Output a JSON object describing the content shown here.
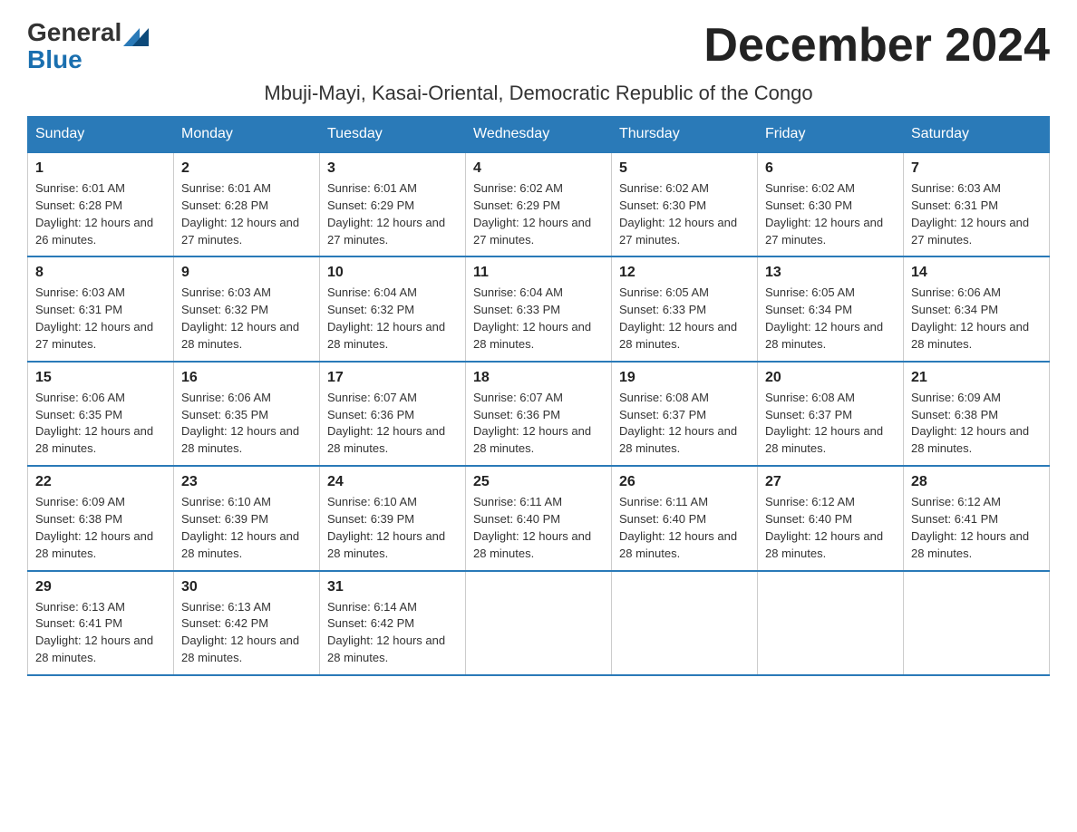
{
  "header": {
    "logo_general": "General",
    "logo_blue": "Blue",
    "page_title": "December 2024",
    "subtitle": "Mbuji-Mayi, Kasai-Oriental, Democratic Republic of the Congo"
  },
  "days_of_week": [
    "Sunday",
    "Monday",
    "Tuesday",
    "Wednesday",
    "Thursday",
    "Friday",
    "Saturday"
  ],
  "weeks": [
    [
      {
        "day": "1",
        "sunrise": "6:01 AM",
        "sunset": "6:28 PM",
        "daylight": "12 hours and 26 minutes."
      },
      {
        "day": "2",
        "sunrise": "6:01 AM",
        "sunset": "6:28 PM",
        "daylight": "12 hours and 27 minutes."
      },
      {
        "day": "3",
        "sunrise": "6:01 AM",
        "sunset": "6:29 PM",
        "daylight": "12 hours and 27 minutes."
      },
      {
        "day": "4",
        "sunrise": "6:02 AM",
        "sunset": "6:29 PM",
        "daylight": "12 hours and 27 minutes."
      },
      {
        "day": "5",
        "sunrise": "6:02 AM",
        "sunset": "6:30 PM",
        "daylight": "12 hours and 27 minutes."
      },
      {
        "day": "6",
        "sunrise": "6:02 AM",
        "sunset": "6:30 PM",
        "daylight": "12 hours and 27 minutes."
      },
      {
        "day": "7",
        "sunrise": "6:03 AM",
        "sunset": "6:31 PM",
        "daylight": "12 hours and 27 minutes."
      }
    ],
    [
      {
        "day": "8",
        "sunrise": "6:03 AM",
        "sunset": "6:31 PM",
        "daylight": "12 hours and 27 minutes."
      },
      {
        "day": "9",
        "sunrise": "6:03 AM",
        "sunset": "6:32 PM",
        "daylight": "12 hours and 28 minutes."
      },
      {
        "day": "10",
        "sunrise": "6:04 AM",
        "sunset": "6:32 PM",
        "daylight": "12 hours and 28 minutes."
      },
      {
        "day": "11",
        "sunrise": "6:04 AM",
        "sunset": "6:33 PM",
        "daylight": "12 hours and 28 minutes."
      },
      {
        "day": "12",
        "sunrise": "6:05 AM",
        "sunset": "6:33 PM",
        "daylight": "12 hours and 28 minutes."
      },
      {
        "day": "13",
        "sunrise": "6:05 AM",
        "sunset": "6:34 PM",
        "daylight": "12 hours and 28 minutes."
      },
      {
        "day": "14",
        "sunrise": "6:06 AM",
        "sunset": "6:34 PM",
        "daylight": "12 hours and 28 minutes."
      }
    ],
    [
      {
        "day": "15",
        "sunrise": "6:06 AM",
        "sunset": "6:35 PM",
        "daylight": "12 hours and 28 minutes."
      },
      {
        "day": "16",
        "sunrise": "6:06 AM",
        "sunset": "6:35 PM",
        "daylight": "12 hours and 28 minutes."
      },
      {
        "day": "17",
        "sunrise": "6:07 AM",
        "sunset": "6:36 PM",
        "daylight": "12 hours and 28 minutes."
      },
      {
        "day": "18",
        "sunrise": "6:07 AM",
        "sunset": "6:36 PM",
        "daylight": "12 hours and 28 minutes."
      },
      {
        "day": "19",
        "sunrise": "6:08 AM",
        "sunset": "6:37 PM",
        "daylight": "12 hours and 28 minutes."
      },
      {
        "day": "20",
        "sunrise": "6:08 AM",
        "sunset": "6:37 PM",
        "daylight": "12 hours and 28 minutes."
      },
      {
        "day": "21",
        "sunrise": "6:09 AM",
        "sunset": "6:38 PM",
        "daylight": "12 hours and 28 minutes."
      }
    ],
    [
      {
        "day": "22",
        "sunrise": "6:09 AM",
        "sunset": "6:38 PM",
        "daylight": "12 hours and 28 minutes."
      },
      {
        "day": "23",
        "sunrise": "6:10 AM",
        "sunset": "6:39 PM",
        "daylight": "12 hours and 28 minutes."
      },
      {
        "day": "24",
        "sunrise": "6:10 AM",
        "sunset": "6:39 PM",
        "daylight": "12 hours and 28 minutes."
      },
      {
        "day": "25",
        "sunrise": "6:11 AM",
        "sunset": "6:40 PM",
        "daylight": "12 hours and 28 minutes."
      },
      {
        "day": "26",
        "sunrise": "6:11 AM",
        "sunset": "6:40 PM",
        "daylight": "12 hours and 28 minutes."
      },
      {
        "day": "27",
        "sunrise": "6:12 AM",
        "sunset": "6:40 PM",
        "daylight": "12 hours and 28 minutes."
      },
      {
        "day": "28",
        "sunrise": "6:12 AM",
        "sunset": "6:41 PM",
        "daylight": "12 hours and 28 minutes."
      }
    ],
    [
      {
        "day": "29",
        "sunrise": "6:13 AM",
        "sunset": "6:41 PM",
        "daylight": "12 hours and 28 minutes."
      },
      {
        "day": "30",
        "sunrise": "6:13 AM",
        "sunset": "6:42 PM",
        "daylight": "12 hours and 28 minutes."
      },
      {
        "day": "31",
        "sunrise": "6:14 AM",
        "sunset": "6:42 PM",
        "daylight": "12 hours and 28 minutes."
      },
      null,
      null,
      null,
      null
    ]
  ]
}
